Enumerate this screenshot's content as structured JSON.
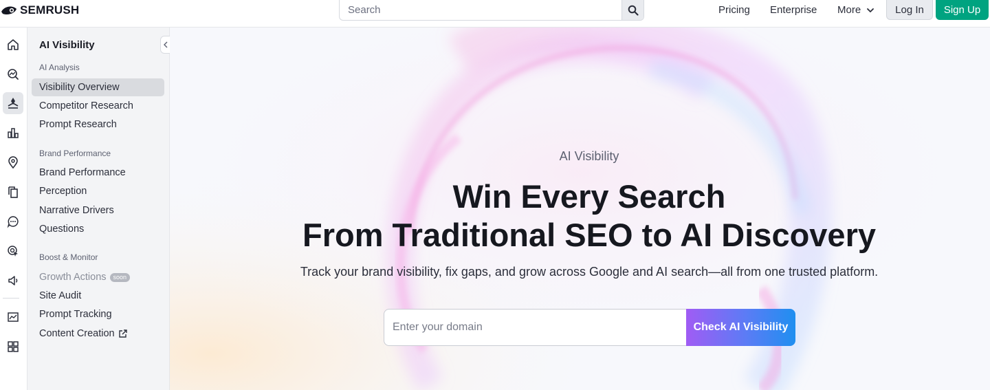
{
  "brand": {
    "name": "SEMRUSH"
  },
  "search": {
    "placeholder": "Search"
  },
  "nav": {
    "pricing": "Pricing",
    "enterprise": "Enterprise",
    "more": "More",
    "login": "Log In",
    "signup": "Sign Up"
  },
  "rail": {
    "icons": [
      "home-icon",
      "seo-icon",
      "ai-visibility-icon",
      "traffic-icon",
      "local-icon",
      "content-icon",
      "social-icon",
      "ads-icon",
      "pr-icon",
      "reports-icon",
      "apps-icon"
    ],
    "active": "ai-visibility-icon"
  },
  "sidebar": {
    "title": "AI Visibility",
    "sections": [
      {
        "label": "AI Analysis",
        "items": [
          {
            "label": "Visibility Overview",
            "active": true
          },
          {
            "label": "Competitor Research"
          },
          {
            "label": "Prompt Research"
          }
        ]
      },
      {
        "label": "Brand Performance",
        "items": [
          {
            "label": "Brand Performance"
          },
          {
            "label": "Perception"
          },
          {
            "label": "Narrative Drivers"
          },
          {
            "label": "Questions"
          }
        ]
      },
      {
        "label": "Boost & Monitor",
        "items": [
          {
            "label": "Growth Actions",
            "badge": "soon",
            "disabled": true
          },
          {
            "label": "Site Audit"
          },
          {
            "label": "Prompt Tracking"
          },
          {
            "label": "Content Creation",
            "external": true
          }
        ]
      }
    ]
  },
  "hero": {
    "eyebrow": "AI Visibility",
    "title_line1": "Win Every Search",
    "title_line2": "From Traditional SEO to AI Discovery",
    "subtitle": "Track your brand visibility, fix gaps, and grow across Google and AI search—all from one trusted platform.",
    "input_placeholder": "Enter your domain",
    "cta": "Check AI Visibility"
  },
  "colors": {
    "signup_bg": "#00a380",
    "cta_gradient_start": "#a05cf4",
    "cta_gradient_end": "#1f8ff0",
    "active_item_bg": "#d9dbdf"
  }
}
